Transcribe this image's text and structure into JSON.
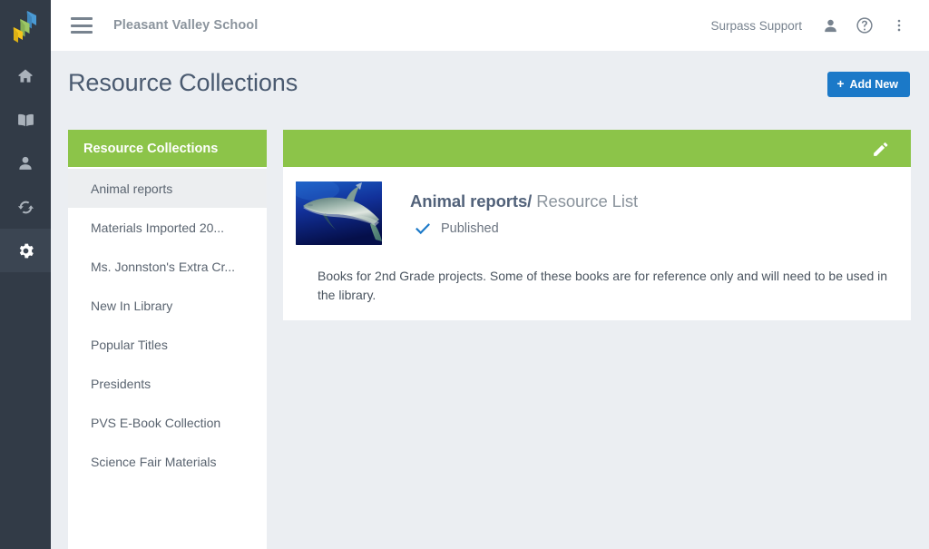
{
  "app": {
    "logo_name": "surpass-logo",
    "logo_colors": [
      "#4a9ad4",
      "#9cc765",
      "#f4c51c"
    ]
  },
  "rail": {
    "items": [
      {
        "name": "home-icon",
        "label": "Home",
        "active": false
      },
      {
        "name": "book-icon",
        "label": "Catalog",
        "active": false
      },
      {
        "name": "person-icon",
        "label": "Patrons",
        "active": false
      },
      {
        "name": "sync-icon",
        "label": "Circulation",
        "active": false
      },
      {
        "name": "gear-icon",
        "label": "Settings",
        "active": true
      }
    ]
  },
  "topbar": {
    "menu_icon": "hamburger-icon",
    "school_name": "Pleasant Valley School",
    "user_name": "Surpass Support",
    "user_icon": "person-icon",
    "help_icon": "help-circle-icon",
    "overflow_icon": "more-vertical-icon"
  },
  "header": {
    "title": "Resource Collections",
    "add_new_label": "Add New",
    "add_new_plus": "+",
    "accent_color": "#1b79c8"
  },
  "collections_panel": {
    "heading": "Resource Collections",
    "header_color": "#8cc449",
    "items": [
      {
        "label": "Animal reports",
        "selected": true
      },
      {
        "label": "Materials Imported 20...",
        "selected": false
      },
      {
        "label": "Ms. Jonnston's Extra Cr...",
        "selected": false
      },
      {
        "label": "New In Library",
        "selected": false
      },
      {
        "label": "Popular Titles",
        "selected": false
      },
      {
        "label": "Presidents",
        "selected": false
      },
      {
        "label": "PVS E-Book Collection",
        "selected": false
      },
      {
        "label": "Science Fair Materials",
        "selected": false
      }
    ]
  },
  "detail_card": {
    "header_color": "#8cc449",
    "edit_icon": "pencil-icon",
    "thumbnail_name": "shark-photo-thumbnail",
    "title": "Animal reports",
    "separator": "/",
    "subtitle": "Resource List",
    "status_icon": "checkmark-icon",
    "status_color": "#1b79c8",
    "status": "Published",
    "description": "Books for 2nd Grade projects. Some of these books are for reference only and will need to be used in the library."
  }
}
